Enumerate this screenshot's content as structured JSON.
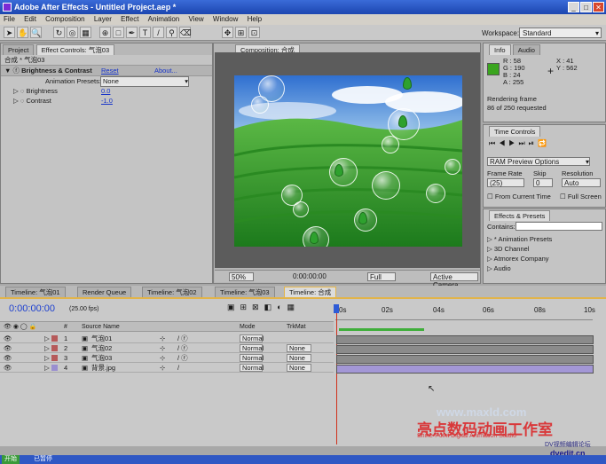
{
  "window": {
    "title": "Adobe After Effects - Untitled Project.aep *",
    "min": "_",
    "max": "□",
    "close": "✕"
  },
  "menu": [
    "File",
    "Edit",
    "Composition",
    "Layer",
    "Effect",
    "Animation",
    "View",
    "Window",
    "Help"
  ],
  "workspace": {
    "label": "Workspace:",
    "value": "Standard"
  },
  "project_panel": {
    "tabs": [
      "Project",
      "Effect Controls: 气泡03"
    ],
    "path": "合成 * 气泡03",
    "effect_name": "Brightness & Contrast",
    "reset": "Reset",
    "about": "About...",
    "presets_label": "Animation Presets:",
    "presets_value": "None",
    "brightness_label": "Brightness",
    "brightness_value": "0.0",
    "contrast_label": "Contrast",
    "contrast_value": "-1.0"
  },
  "comp_panel": {
    "tab": "Composition: 合成",
    "zoom": "50%",
    "time": "0:00:00:00",
    "resolution": "Full",
    "camera": "Active Camera"
  },
  "info_panel": {
    "tabs": [
      "Info",
      "Audio"
    ],
    "r": "R : 58",
    "g": "G : 190",
    "b": "B : 24",
    "a": "A : 255",
    "x": "X : 41",
    "y": "Y : 562",
    "color": "#3aa51e",
    "rendering": "Rendering frame",
    "progress": "86 of 250 requested"
  },
  "time_controls": {
    "tab": "Time Controls",
    "ram_preview": "RAM Preview Options",
    "frame_rate_label": "Frame Rate",
    "skip_label": "Skip",
    "resolution_label": "Resolution",
    "frame_rate": "(25)",
    "skip": "0",
    "resolution": "Auto",
    "from_current": "From Current Time",
    "full_screen": "Full Screen"
  },
  "effects_presets": {
    "tab": "Effects & Presets",
    "contains_label": "Contains:",
    "items": [
      "* Animation Presets",
      "3D Channel",
      "Atmorex Company",
      "Audio"
    ]
  },
  "timeline_tabs": [
    "Timeline: 气泡01",
    "Render Queue",
    "Timeline: 气泡02",
    "Timeline: 气泡03",
    "Timeline: 合成"
  ],
  "timeline": {
    "current_time": "0:00:00:00",
    "fps": "(25.00 fps)",
    "ruler": [
      "0s",
      "02s",
      "04s",
      "06s",
      "08s",
      "10s"
    ],
    "headers": {
      "num": "#",
      "source": "Source Name",
      "mode": "Mode",
      "trkmat": "TrkMat"
    },
    "layers": [
      {
        "num": "1",
        "name": "气泡01",
        "mode": "Normal",
        "trkmat": "",
        "color": "#b65a5a"
      },
      {
        "num": "2",
        "name": "气泡02",
        "mode": "Normal",
        "trkmat": "None",
        "color": "#b65a5a"
      },
      {
        "num": "3",
        "name": "气泡03",
        "mode": "Normal",
        "trkmat": "None",
        "color": "#b65a5a"
      },
      {
        "num": "4",
        "name": "背景.jpg",
        "mode": "Normal",
        "trkmat": "None",
        "color": "#9a8fd0"
      }
    ]
  },
  "watermark": {
    "url": "www.maxld.com",
    "brand": "亮点数码动画工作室",
    "english": "Shine-Point Digital Animation Studio",
    "forum_top": "DV视频编辑论坛",
    "forum": "dvedit.cn"
  },
  "taskbar": {
    "start": "开始",
    "item": "已暂停"
  }
}
